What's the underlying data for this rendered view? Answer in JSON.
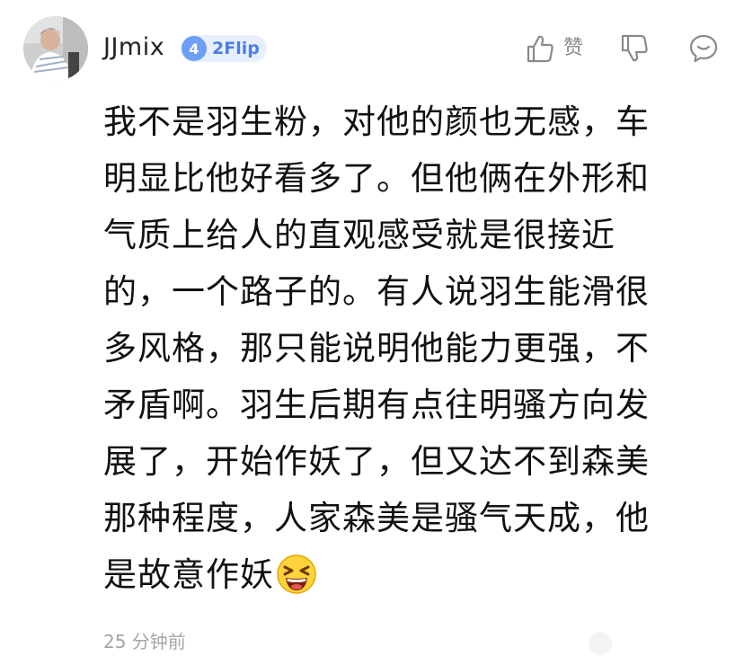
{
  "comment": {
    "author": {
      "name": "JJmix",
      "level": "4",
      "level_name": "2Flip"
    },
    "actions": {
      "like_label": "赞"
    },
    "body_lines": [
      "我不是羽生粉，对他的颜也无感，车",
      "明显比他好看多了。但他俩在外形和",
      "气质上给人的直观感受就是很接近",
      "的，一个路子的。有人说羽生能滑很",
      "多风格，那只能说明他能力更强，不",
      "矛盾啊。羽生后期有点往明骚方向发",
      "展了，开始作妖了，但又达不到森美",
      "那种程度，人家森美是骚气天成，他",
      "是故意作妖"
    ],
    "emoji": "grinning-squinting-face",
    "timestamp": "25 分钟前"
  },
  "colors": {
    "badge_bg": "#e7efff",
    "badge_accent": "#6d9ff7",
    "badge_text": "#4a7fe8",
    "muted": "#a5a5a5"
  }
}
